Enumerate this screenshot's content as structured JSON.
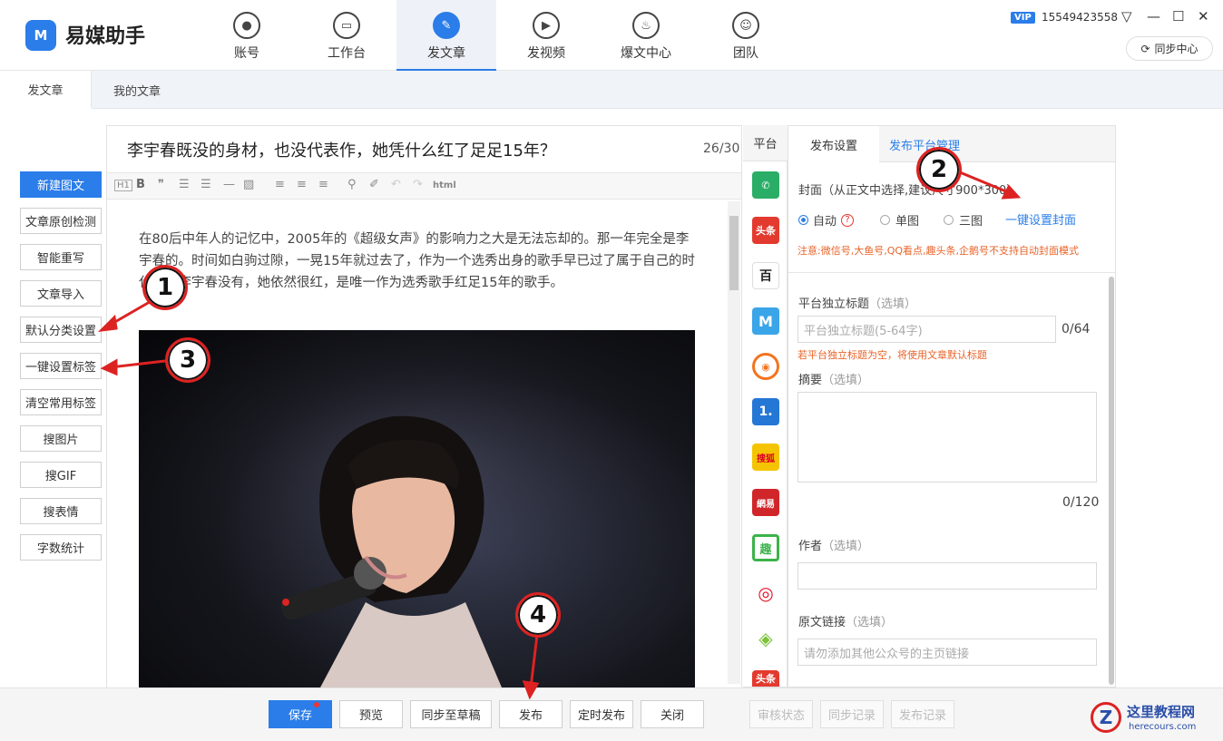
{
  "app": {
    "logo_mark": "M",
    "name": "易媒助手"
  },
  "nav": [
    {
      "label": "账号",
      "icon": "user-icon"
    },
    {
      "label": "工作台",
      "icon": "monitor-icon"
    },
    {
      "label": "发文章",
      "icon": "feather-icon"
    },
    {
      "label": "发视频",
      "icon": "play-icon"
    },
    {
      "label": "爆文中心",
      "icon": "fire-icon"
    },
    {
      "label": "团队",
      "icon": "team-icon"
    }
  ],
  "user": {
    "vip": "VIP",
    "phone": "15549423558",
    "sync": "同步中心"
  },
  "subtabs": [
    "发文章",
    "我的文章"
  ],
  "left_buttons": [
    "新建图文",
    "文章原创检测",
    "智能重写",
    "文章导入",
    "默认分类设置",
    "一键设置标签",
    "清空常用标签",
    "搜图片",
    "搜GIF",
    "搜表情",
    "字数统计"
  ],
  "article": {
    "title": "李宇春既没的身材，也没代表作，她凭什么红了足足15年？",
    "count": "26/30",
    "body": "在80后中年人的记忆中，2005年的《超级女声》的影响力之大是无法忘却的。那一年完全是李宇春的。时间如白驹过隙，一晃15年就过去了，作为一个选秀出身的歌手早已过了属于自己的时代，但李宇春没有，她依然很红，是唯一作为选秀歌手红足15年的歌手。",
    "toolbar_html": "html"
  },
  "platforms": {
    "header": "平台",
    "items": [
      {
        "name": "wechat",
        "text": "",
        "color": "#2aae67"
      },
      {
        "name": "toutiao",
        "text": "头条",
        "color": "#e33a2f"
      },
      {
        "name": "baijia",
        "text": "百",
        "color": "#ffffff"
      },
      {
        "name": "dayu",
        "text": "M",
        "color": "#3aa5e8"
      },
      {
        "name": "qq-kandian",
        "text": "",
        "color": "#f2741f"
      },
      {
        "name": "yidian",
        "text": "1.",
        "color": "#2577d6"
      },
      {
        "name": "sohu",
        "text": "搜狐",
        "color": "#f5c400"
      },
      {
        "name": "wangyi",
        "text": "網易",
        "color": "#d0262a"
      },
      {
        "name": "qutoutiao",
        "text": "趣",
        "color": "#3cb34a"
      },
      {
        "name": "weibo",
        "text": "",
        "color": "#e6162d"
      },
      {
        "name": "aiqiyi",
        "text": "",
        "color": "#7cc23a"
      },
      {
        "name": "toutiao2",
        "text": "头条",
        "color": "#e33a2f"
      }
    ]
  },
  "right_panel": {
    "tabs": [
      "发布设置",
      "发布平台管理"
    ],
    "cover_label": "封面（从正文中选择,建议尺寸900*300）",
    "cover_options": [
      "自动",
      "单图",
      "三图"
    ],
    "cover_link": "一键设置封面",
    "cover_hint": "注意:微信号,大鱼号,QQ看点,趣头条,企鹅号不支持自动封面模式",
    "title_label": "平台独立标题",
    "optional": "（选填）",
    "title_placeholder": "平台独立标题(5-64字)",
    "title_count": "0/64",
    "title_hint": "若平台独立标题为空，将使用文章默认标题",
    "summary_label": "摘要",
    "summary_count": "0/120",
    "author_label": "作者",
    "link_label": "原文链接",
    "link_placeholder": "请勿添加其他公众号的主页链接"
  },
  "bottom_buttons": {
    "save": "保存",
    "preview": "预览",
    "draft": "同步至草稿",
    "publish": "发布",
    "schedule": "定时发布",
    "close": "关闭",
    "audit": "审核状态",
    "sync_record": "同步记录",
    "publish_record": "发布记录"
  },
  "markers": [
    "1",
    "2",
    "3",
    "4"
  ],
  "watermark": {
    "title": "这里教程网",
    "url": "herecours.com"
  },
  "colors": {
    "accent": "#2b7de9",
    "hint": "#e8642a",
    "marker": "#dd2222"
  }
}
